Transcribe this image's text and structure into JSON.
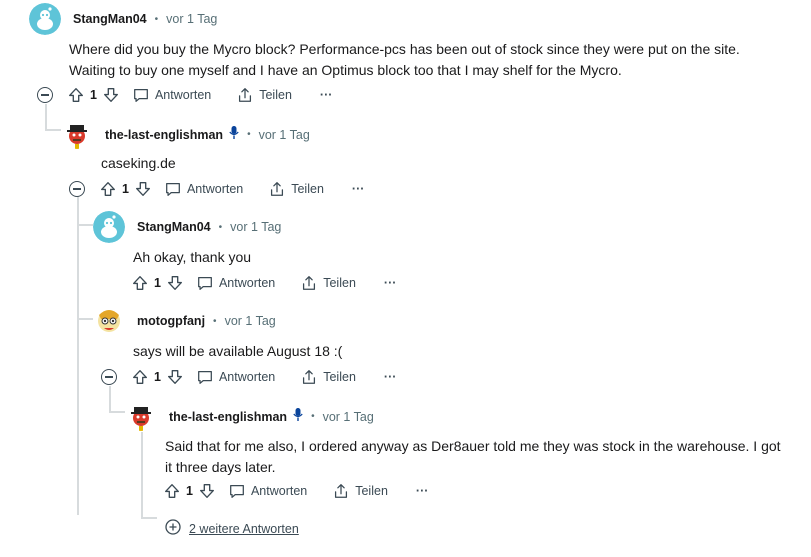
{
  "comments": [
    {
      "user": "StangMan04",
      "time": "vor 1 Tag",
      "text_lines": [
        "Where did you buy the Mycro block? Performance-pcs has been out of stock since they were put on the site.",
        "Waiting to buy one myself and I have an Optimus block too that I may shelf for the Mycro."
      ],
      "votes": "1",
      "reply": "Antworten",
      "share": "Teilen",
      "more": "···"
    },
    {
      "user": "the-last-englishman",
      "time": "vor 1 Tag",
      "text_lines": [
        "caseking.de"
      ],
      "votes": "1",
      "reply": "Antworten",
      "share": "Teilen",
      "more": "···"
    },
    {
      "user": "StangMan04",
      "time": "vor 1 Tag",
      "text_lines": [
        "Ah okay, thank you"
      ],
      "votes": "1",
      "reply": "Antworten",
      "share": "Teilen",
      "more": "···"
    },
    {
      "user": "motogpfanj",
      "time": "vor 1 Tag",
      "text_lines": [
        "says will be available August 18 :("
      ],
      "votes": "1",
      "reply": "Antworten",
      "share": "Teilen",
      "more": "···"
    },
    {
      "user": "the-last-englishman",
      "time": "vor 1 Tag",
      "text_lines": [
        "Said that for me also, I ordered anyway as Der8auer told me they was stock in the warehouse. I got",
        "it three days later."
      ],
      "votes": "1",
      "reply": "Antworten",
      "share": "Teilen",
      "more": "···"
    }
  ],
  "dot_separator": "•",
  "more_replies": "2 weitere Antworten",
  "colors": {
    "accent": "#0a449b",
    "line": "#d7dbdd",
    "snoo_bg": "#5ec4d8"
  }
}
